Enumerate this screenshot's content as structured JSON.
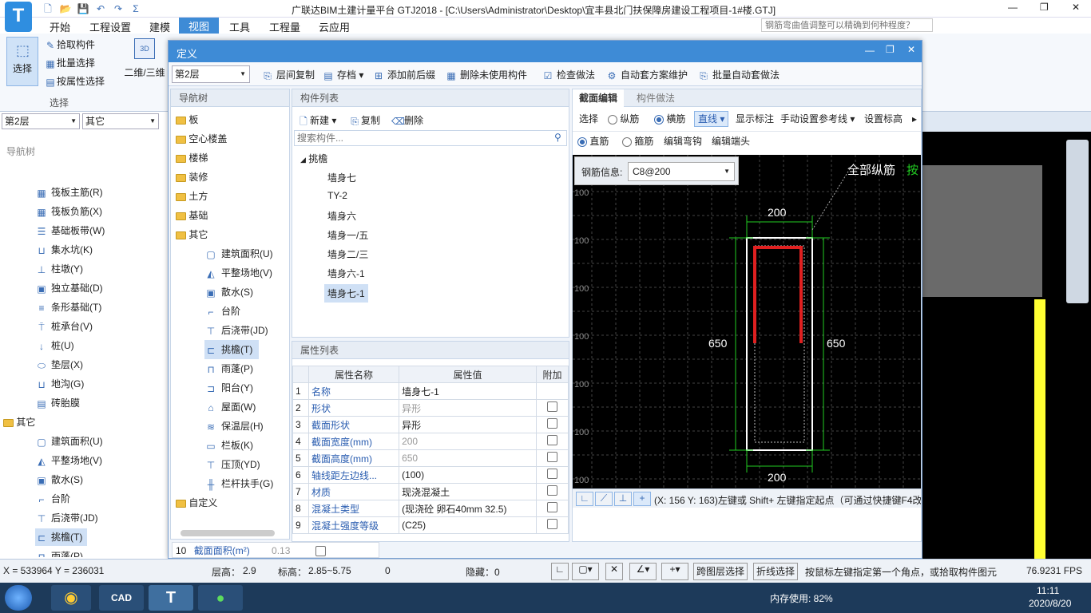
{
  "app": {
    "title": "广联达BIM土建计量平台 GTJ2018 - [C:\\Users\\Administrator\\Desktop\\宜丰县北门扶保障房建设工程项目-1#楼.GTJ]",
    "search_placeholder": "钢筋弯曲值调整可以精确到何种程度？",
    "win_min": "—",
    "win_restore": "❐",
    "win_close": "✕"
  },
  "menu": [
    "开始",
    "工程设置",
    "建模",
    "视图",
    "工具",
    "工程量",
    "云应用"
  ],
  "ribbon": {
    "select_label": "选择",
    "pick_label": "拾取构件",
    "batch_label": "批量选择",
    "attr_label": "按属性选择",
    "group_label": "选择",
    "view_label": "二维/三维"
  },
  "left": {
    "floor": "第2层",
    "type": "其它",
    "nav_title": "导航树",
    "items": [
      "筏板主筋(R)",
      "筏板负筋(X)",
      "基础板带(W)",
      "集水坑(K)",
      "柱墩(Y)",
      "独立基础(D)",
      "条形基础(T)",
      "桩承台(V)",
      "桩(U)",
      "垫层(X)",
      "地沟(G)",
      "砖胎膜"
    ],
    "other_folder": "其它",
    "other_items": [
      "建筑面积(U)",
      "平整场地(V)",
      "散水(S)",
      "台阶",
      "后浇带(JD)",
      "挑檐(T)",
      "雨蓬(P)"
    ]
  },
  "dialog": {
    "title": "定义",
    "floor": "第2层",
    "toolbar": [
      "层间复制",
      "存档",
      "添加前后缀",
      "删除未使用构件",
      "检查做法",
      "自动套方案维护",
      "批量自动套做法"
    ],
    "nav_title": "导航树",
    "tree_folders": [
      "板",
      "空心楼盖",
      "楼梯",
      "装修",
      "土方",
      "基础",
      "其它"
    ],
    "tree_other": [
      "建筑面积(U)",
      "平整场地(V)",
      "散水(S)",
      "台阶",
      "后浇带(JD)",
      "挑檐(T)",
      "雨蓬(P)",
      "阳台(Y)",
      "屋面(W)",
      "保温层(H)",
      "栏板(K)",
      "压顶(YD)",
      "栏杆扶手(G)"
    ],
    "tree_custom": "自定义",
    "complist_title": "构件列表",
    "new_label": "新建",
    "copy_label": "复制",
    "delete_label": "删除",
    "search_placeholder": "搜索构件...",
    "group_name": "挑檐",
    "components": [
      "墙身七",
      "TY-2",
      "墙身六",
      "墙身一/五",
      "墙身二/三",
      "墙身六-1",
      "墙身七-1"
    ],
    "proplist_title": "属性列表",
    "prop_headers": [
      "属性名称",
      "属性值",
      "附加"
    ],
    "props": [
      {
        "no": "1",
        "name": "名称",
        "value": "墙身七-1",
        "grey": false,
        "cb": false
      },
      {
        "no": "2",
        "name": "形状",
        "value": "异形",
        "grey": true,
        "cb": true
      },
      {
        "no": "3",
        "name": "截面形状",
        "value": "异形",
        "grey": false,
        "cb": true
      },
      {
        "no": "4",
        "name": "截面宽度(mm)",
        "value": "200",
        "grey": true,
        "cb": true
      },
      {
        "no": "5",
        "name": "截面高度(mm)",
        "value": "650",
        "grey": true,
        "cb": true
      },
      {
        "no": "6",
        "name": "轴线距左边线...",
        "value": "(100)",
        "grey": false,
        "cb": true
      },
      {
        "no": "7",
        "name": "材质",
        "value": "现浇混凝土",
        "grey": false,
        "cb": true
      },
      {
        "no": "8",
        "name": "混凝土类型",
        "value": "(现浇砼 卵石40mm 32.5)",
        "grey": false,
        "cb": true
      },
      {
        "no": "9",
        "name": "混凝土强度等级",
        "value": "(C25)",
        "grey": false,
        "cb": true
      }
    ],
    "prop10": {
      "no": "10",
      "name": "截面面积(m²)",
      "value": "0.13"
    },
    "tab_section": "截面编辑",
    "tab_method": "构件做法",
    "edit_tools": [
      "选择",
      "纵筋",
      "横筋",
      "直线",
      "显示标注",
      "手动设置参考线",
      "设置标高"
    ],
    "edit_tools2": [
      "直筋",
      "箍筋",
      "编辑弯钩",
      "编辑端头"
    ],
    "rebar_info_label": "钢筋信息:",
    "rebar_info_value": "C8@200",
    "all_long": "全部纵筋",
    "all_long2": "按",
    "dim_top": "200",
    "dim_bottom": "200",
    "dim_left": "650",
    "dim_right": "650",
    "grid_label": "100",
    "coord_hint": "(X: 156 Y: 163)左键或 Shift+ 左键指定起点（可通过快捷键F4改"
  },
  "status": {
    "coords": "X = 533964 Y = 236031",
    "floor_h_label": "层高：",
    "floor_h": "2.9",
    "elev_label": "标高：",
    "elev": "2.85~5.75",
    "zero": "0",
    "hidden": "隐藏：0",
    "cross_select": "跨图层选择",
    "poly_select": "折线选择",
    "hint": "按鼠标左键指定第一个角点，或拾取构件图元",
    "fps": "76.9231 FPS"
  },
  "taskbar": {
    "mem": "内存使用: 82%",
    "time": "11:11",
    "date": "2020/8/20",
    "cad": "CAD"
  },
  "colors": {
    "accent": "#3e8bd6",
    "rebar": "#e02020",
    "dim": "#22cc22"
  }
}
